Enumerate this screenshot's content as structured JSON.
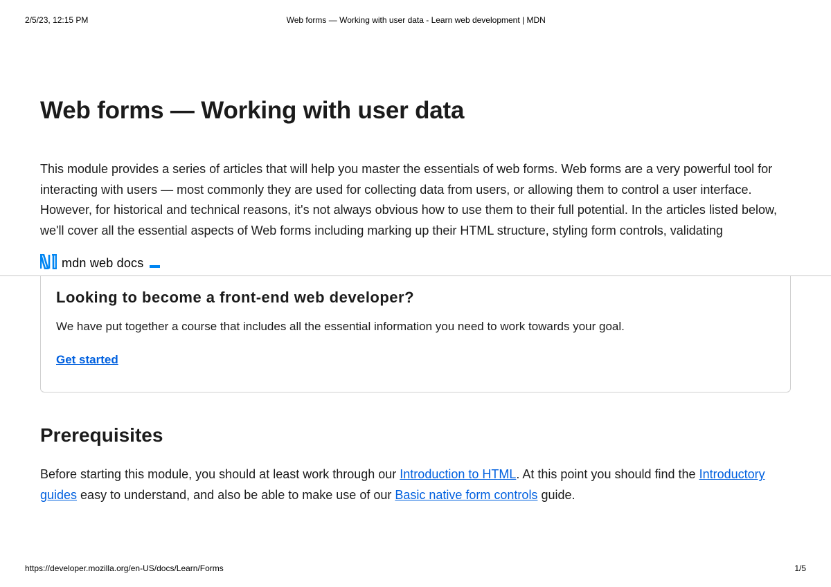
{
  "print_header": {
    "timestamp": "2/5/23, 12:15 PM",
    "title": "Web forms — Working with user data - Learn web development | MDN"
  },
  "page_title": "Web forms — Working with user data",
  "intro": "This module provides a series of articles that will help you master the essentials of web forms. Web forms are a very powerful tool for interacting with users — most commonly they are used for collecting data from users, or allowing them to control a user interface. However, for historical and technical reasons, it's not always obvious how to use them to their full potential. In the articles listed below, we'll cover all the essential aspects of Web forms including marking up their HTML structure, styling form controls, validating",
  "logo_text": "mdn web docs",
  "callout": {
    "heading": "Looking to become a front-end web developer?",
    "body": "We have put together a course that includes all the essential information you need to work towards your goal.",
    "cta": "Get started"
  },
  "prerequisites": {
    "heading": "Prerequisites",
    "text_before_link1": "Before starting this module, you should at least work through our ",
    "link1": "Introduction to HTML",
    "text_mid1": ". At this point you should find the ",
    "link2": "Introductory guides",
    "text_mid2": " easy to understand, and also be able to make use of our ",
    "link3": "Basic native form controls",
    "text_after": " guide."
  },
  "print_footer": {
    "url": "https://developer.mozilla.org/en-US/docs/Learn/Forms",
    "page": "1/5"
  }
}
